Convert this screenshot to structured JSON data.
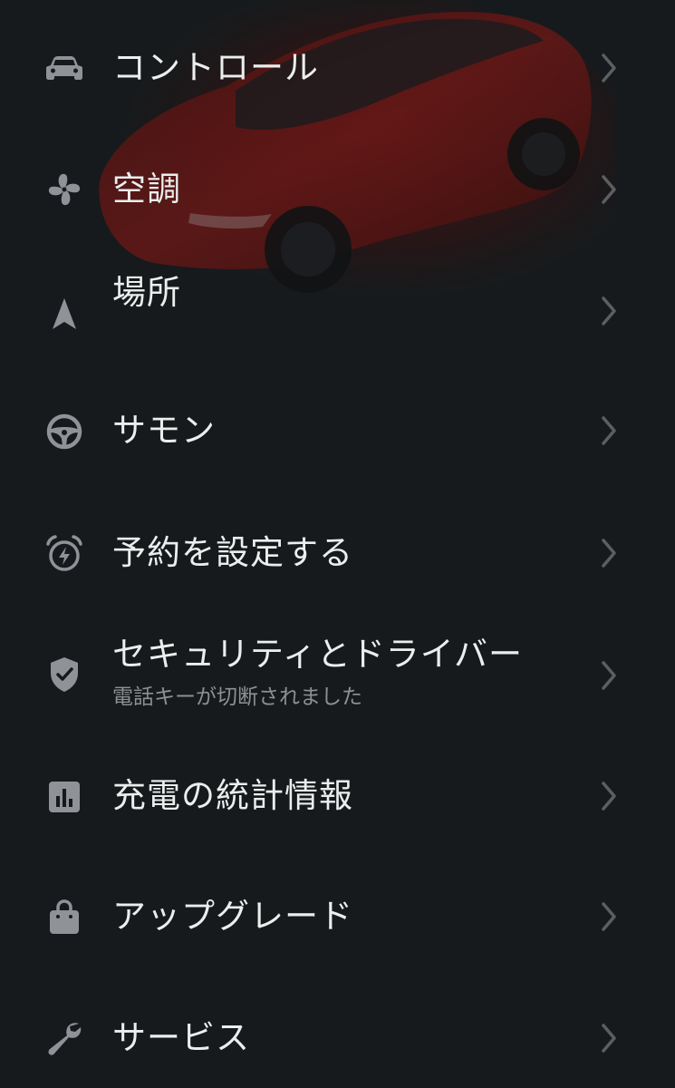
{
  "menu": {
    "items": [
      {
        "label": "コントロール",
        "icon": "car-icon",
        "sublabel": ""
      },
      {
        "label": "空調",
        "icon": "fan-icon",
        "sublabel": ""
      },
      {
        "label": "場所",
        "icon": "location-arrow-icon",
        "sublabel": ""
      },
      {
        "label": "サモン",
        "icon": "steering-wheel-icon",
        "sublabel": ""
      },
      {
        "label": "予約を設定する",
        "icon": "alarm-clock-icon",
        "sublabel": ""
      },
      {
        "label": "セキュリティとドライバー",
        "icon": "shield-check-icon",
        "sublabel": "電話キーが切断されました"
      },
      {
        "label": "充電の統計情報",
        "icon": "bar-chart-icon",
        "sublabel": ""
      },
      {
        "label": "アップグレード",
        "icon": "shopping-bag-icon",
        "sublabel": ""
      },
      {
        "label": "サービス",
        "icon": "wrench-icon",
        "sublabel": ""
      }
    ],
    "chevron_icon": "chevron-right-icon"
  },
  "colors": {
    "background": "#161a1c",
    "text": "#eceded",
    "subtext": "#8d9194",
    "icon": "#8f9397",
    "chevron": "#5b5f62",
    "car_accent": "#7a1a18"
  }
}
